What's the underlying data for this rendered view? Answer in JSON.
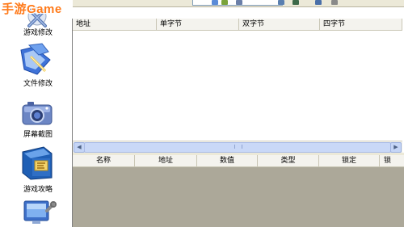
{
  "watermark": "手游Game",
  "sidebar": {
    "items": [
      {
        "label": "游戏修改",
        "icon": "game-modify-icon"
      },
      {
        "label": "文件修改",
        "icon": "file-modify-icon"
      },
      {
        "label": "屏幕截图",
        "icon": "camera-icon"
      },
      {
        "label": "游戏攻略",
        "icon": "guide-book-icon"
      },
      {
        "label": "",
        "icon": "computer-tools-icon"
      }
    ]
  },
  "top_grid": {
    "columns": [
      "地址",
      "单字节",
      "双字节",
      "四字节"
    ]
  },
  "bottom_grid": {
    "columns": [
      "名称",
      "地址",
      "数值",
      "类型",
      "锁定",
      "锁"
    ]
  },
  "colors": {
    "watermark": "#ff7a1a",
    "empty_grid_bg": "#aca899",
    "scrollbar": "#c9d8f7"
  }
}
